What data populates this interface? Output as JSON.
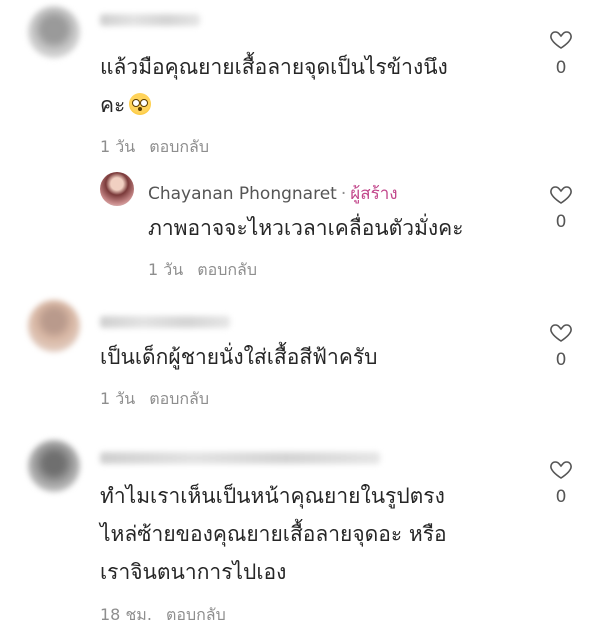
{
  "comments": [
    {
      "text_lines": [
        "แล้วมือคุณยายเสื้อลายจุดเป็นไรข้างนึง",
        "คะ"
      ],
      "emoji": "flushed-face",
      "time": "1 วัน",
      "reply_label": "ตอบกลับ",
      "likes": "0"
    },
    {
      "author": "Chayanan Phongnaret",
      "creator_badge": "ผู้สร้าง",
      "separator": "·",
      "text_lines": [
        "ภาพอาจจะไหวเวลาเคลื่อนตัวมั่งคะ"
      ],
      "time": "1 วัน",
      "reply_label": "ตอบกลับ",
      "likes": "0"
    },
    {
      "text_lines": [
        "เป็นเด็กผู้ชายนั่งใส่เสื้อสีฟ้าครับ"
      ],
      "time": "1 วัน",
      "reply_label": "ตอบกลับ",
      "likes": "0"
    },
    {
      "text_lines": [
        "ทำไมเราเห็นเป็นหน้าคุณยายในรูปตรง",
        "ไหล่ซ้ายของคุณยายเสื้อลายจุดอะ หรือ",
        "เราจินตนาการไปเอง"
      ],
      "time": "18 ชม.",
      "reply_label": "ตอบกลับ",
      "likes": "0"
    }
  ],
  "icons": {
    "like": "heart-outline-icon"
  },
  "colors": {
    "text": "#262626",
    "meta": "#8e8e8e",
    "creator": "#c2478b"
  }
}
